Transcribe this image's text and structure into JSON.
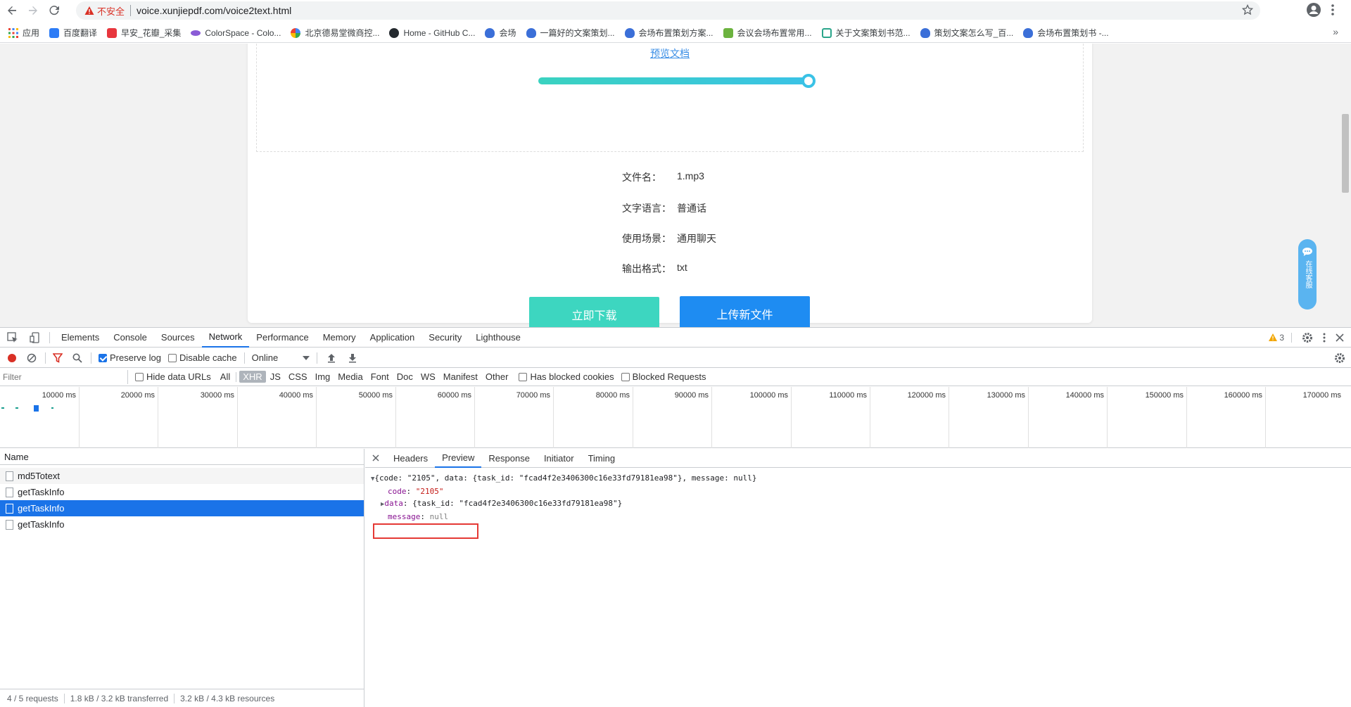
{
  "browser": {
    "security_label": "不安全",
    "url": "voice.xunjiepdf.com/voice2text.html",
    "bookmarks": [
      "应用",
      "百度翻译",
      "早安_花瓣_采集",
      "ColorSpace - Colo...",
      "北京德易堂微商控...",
      "Home - GitHub C...",
      "会场",
      "一篇好的文案策划...",
      "会场布置策划方案...",
      "会议会场布置常用...",
      "关于文案策划书范...",
      "策划文案怎么写_百...",
      "会场布置策划书 -..."
    ],
    "bookmarks_more": "»"
  },
  "page": {
    "preview_link": "预览文档",
    "progress_fraction": 1.0,
    "info": [
      {
        "label": "文件名：",
        "value": "1.mp3"
      },
      {
        "label": "文字语言：",
        "value": "普通话"
      },
      {
        "label": "使用场景：",
        "value": "通用聊天"
      },
      {
        "label": "输出格式：",
        "value": "txt"
      }
    ],
    "download_button": "立即下载",
    "upload_button": "上传新文件",
    "support_label": "在线客服"
  },
  "devtools": {
    "tabs": [
      "Elements",
      "Console",
      "Sources",
      "Network",
      "Performance",
      "Memory",
      "Application",
      "Security",
      "Lighthouse"
    ],
    "active_tab": "Network",
    "warning_count": "3",
    "preserve_log": "Preserve log",
    "disable_cache": "Disable cache",
    "throttle": "Online",
    "filter_placeholder": "Filter",
    "hide_data_urls": "Hide data URLs",
    "types": [
      "All",
      "XHR",
      "JS",
      "CSS",
      "Img",
      "Media",
      "Font",
      "Doc",
      "WS",
      "Manifest",
      "Other"
    ],
    "active_type": "XHR",
    "has_blocked_cookies": "Has blocked cookies",
    "blocked_requests": "Blocked Requests",
    "timeline_ticks": [
      "10000 ms",
      "20000 ms",
      "30000 ms",
      "40000 ms",
      "50000 ms",
      "60000 ms",
      "70000 ms",
      "80000 ms",
      "90000 ms",
      "100000 ms",
      "110000 ms",
      "120000 ms",
      "130000 ms",
      "140000 ms",
      "150000 ms",
      "160000 ms",
      "170000 ms"
    ],
    "name_header": "Name",
    "requests": [
      "md5Totext",
      "getTaskInfo",
      "getTaskInfo",
      "getTaskInfo"
    ],
    "selected_request_index": 2,
    "footer": [
      "4 / 5 requests",
      "1.8 kB / 3.2 kB transferred",
      "3.2 kB / 4.3 kB resources"
    ],
    "detail_tabs": [
      "Headers",
      "Preview",
      "Response",
      "Initiator",
      "Timing"
    ],
    "active_detail_tab": "Preview",
    "preview": {
      "summary": "{code: \"2105\", data: {task_id: \"fcad4f2e3406300c16e33fd79181ea98\"}, message: null}",
      "code_key": "code",
      "code_value": "\"2105\"",
      "data_key": "data",
      "data_value": "{task_id: \"fcad4f2e3406300c16e33fd79181ea98\"}",
      "message_key": "message",
      "message_value": "null"
    }
  },
  "colors": {
    "accent": "#1a73e8",
    "teal": "#3dd6c0",
    "upload_blue": "#1e8cf2",
    "highlight_red": "#e53935"
  }
}
